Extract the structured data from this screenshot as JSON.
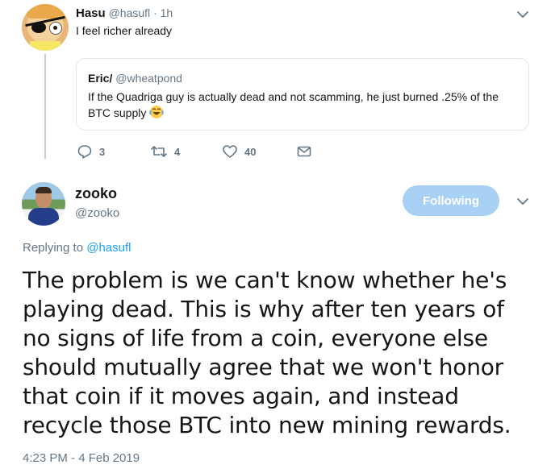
{
  "parent_tweet": {
    "name": "Hasu",
    "handle": "@hasufl",
    "separator": "·",
    "time": "1h",
    "text": "I feel richer already",
    "quoted": {
      "name": "Eric/",
      "handle": "@wheatpond",
      "text": "If the Quadriga guy is actually dead and not scamming, he just burned .25% of the BTC supply",
      "emoji": "rolling-on-floor-laughing-emoji"
    },
    "actions": {
      "replies": "3",
      "retweets": "4",
      "likes": "40"
    }
  },
  "main_tweet": {
    "name": "zooko",
    "handle": "@zooko",
    "follow_label": "Following",
    "replying_prefix": "Replying to",
    "replying_handle": "@hasufl",
    "text": "The problem is we can't know whether he's playing dead. This is why after ten years of no signs of life from a coin, everyone else should mutually agree that we won't honor that coin if it moves again, and instead recycle those BTC into new mining rewards.",
    "timestamp": "4:23 PM - 4 Feb 2019"
  },
  "colors": {
    "accent": "#1da1f2",
    "follow_button": "#a8d1f5",
    "secondary_text": "#657786",
    "border": "#e1e8ed"
  },
  "icons": [
    "reply-icon",
    "retweet-icon",
    "like-icon",
    "direct-message-icon",
    "chevron-down-icon"
  ]
}
